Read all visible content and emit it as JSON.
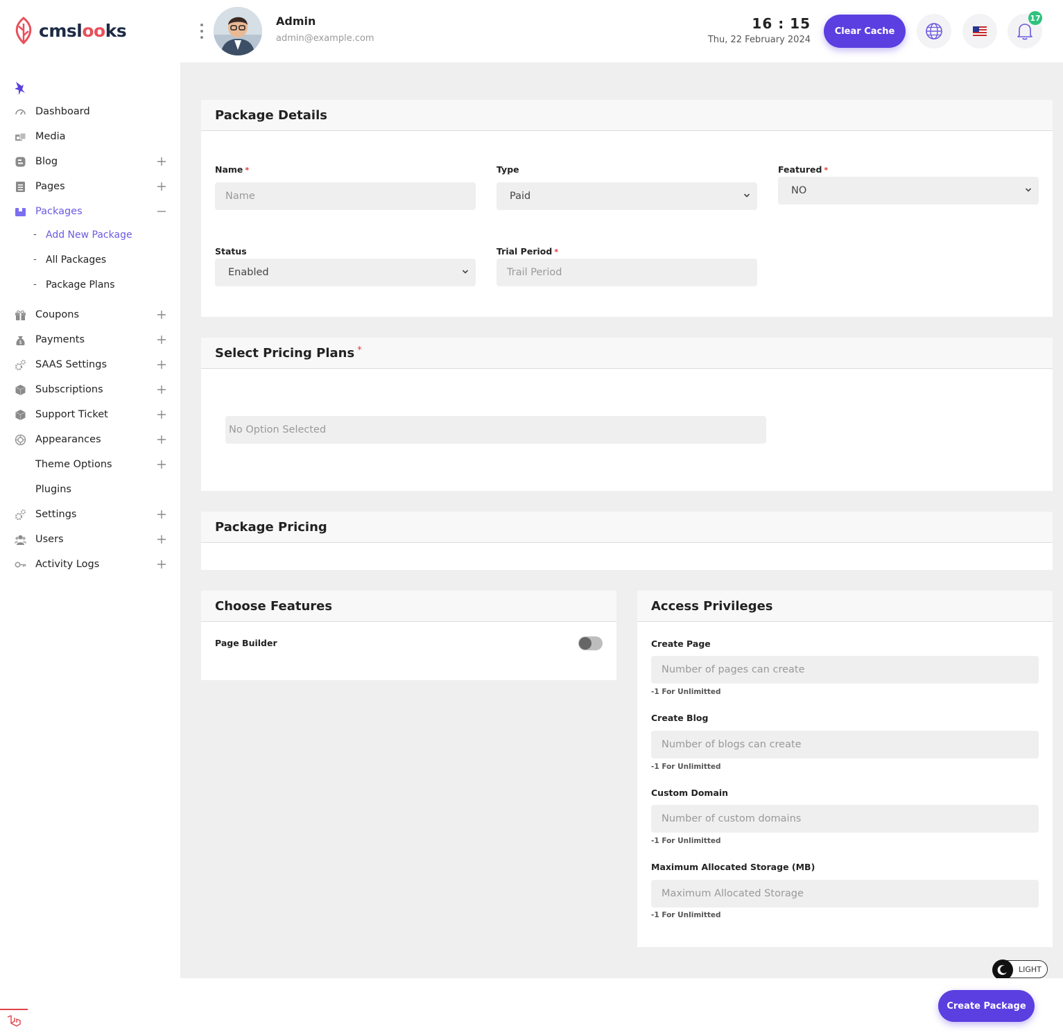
{
  "brand": {
    "name_main": "cmsl",
    "name_accent": "oo",
    "name_tail": "ks"
  },
  "header": {
    "user_name": "Admin",
    "user_email": "admin@example.com",
    "time": "16 : 15",
    "date": "Thu, 22 February 2024",
    "clear_cache_label": "Clear Cache",
    "notification_count": "17"
  },
  "sidebar": {
    "items": [
      {
        "label": "Dashboard",
        "icon": "dashboard-gauge-icon"
      },
      {
        "label": "Media",
        "icon": "media-icon"
      },
      {
        "label": "Blog",
        "icon": "blog-icon"
      },
      {
        "label": "Pages",
        "icon": "pages-icon"
      },
      {
        "label": "Packages",
        "icon": "packages-icon"
      },
      {
        "label": "Coupons",
        "icon": "coupons-icon"
      },
      {
        "label": "Payments",
        "icon": "payments-icon"
      },
      {
        "label": "SAAS Settings",
        "icon": "gears-icon"
      },
      {
        "label": "Subscriptions",
        "icon": "cube-icon"
      },
      {
        "label": "Support Ticket",
        "icon": "cube-icon"
      },
      {
        "label": "Appearances",
        "icon": "appearance-icon"
      },
      {
        "label": "Theme Options",
        "icon": ""
      },
      {
        "label": "Plugins",
        "icon": ""
      },
      {
        "label": "Settings",
        "icon": "gears-icon"
      },
      {
        "label": "Users",
        "icon": "users-icon"
      },
      {
        "label": "Activity Logs",
        "icon": "key-icon"
      }
    ],
    "packages_sub": [
      {
        "label": "Add New Package"
      },
      {
        "label": "All Packages"
      },
      {
        "label": "Package Plans"
      }
    ]
  },
  "package_details": {
    "title": "Package Details",
    "name_label": "Name",
    "name_placeholder": "Name",
    "type_label": "Type",
    "type_value": "Paid",
    "featured_label": "Featured",
    "featured_value": "NO",
    "status_label": "Status",
    "status_value": "Enabled",
    "trial_label": "Trial Period",
    "trial_placeholder": "Trail Period"
  },
  "pricing_plans": {
    "title": "Select Pricing Plans",
    "select_placeholder": "No Option Selected"
  },
  "package_pricing": {
    "title": "Package Pricing"
  },
  "features": {
    "title": "Choose Features",
    "page_builder_label": "Page Builder",
    "page_builder_enabled": false
  },
  "privileges": {
    "title": "Access Privileges",
    "create_page_label": "Create Page",
    "create_page_placeholder": "Number of pages can create",
    "create_blog_label": "Create Blog",
    "create_blog_placeholder": "Number of blogs can create",
    "custom_domain_label": "Custom Domain",
    "custom_domain_placeholder": "Number of custom domains",
    "storage_label": "Maximum Allocated Storage (MB)",
    "storage_placeholder": "Maximum Allocated Storage",
    "unlimited_hint": "-1 For Unlimitted"
  },
  "footer": {
    "create_label": "Create Package",
    "theme_label": "LIGHT"
  },
  "colors": {
    "accent": "#5b3fe0",
    "active_menu": "#6a5ae0",
    "required": "#e53935",
    "badge": "#2ec27e",
    "brand": "#e8505b"
  }
}
